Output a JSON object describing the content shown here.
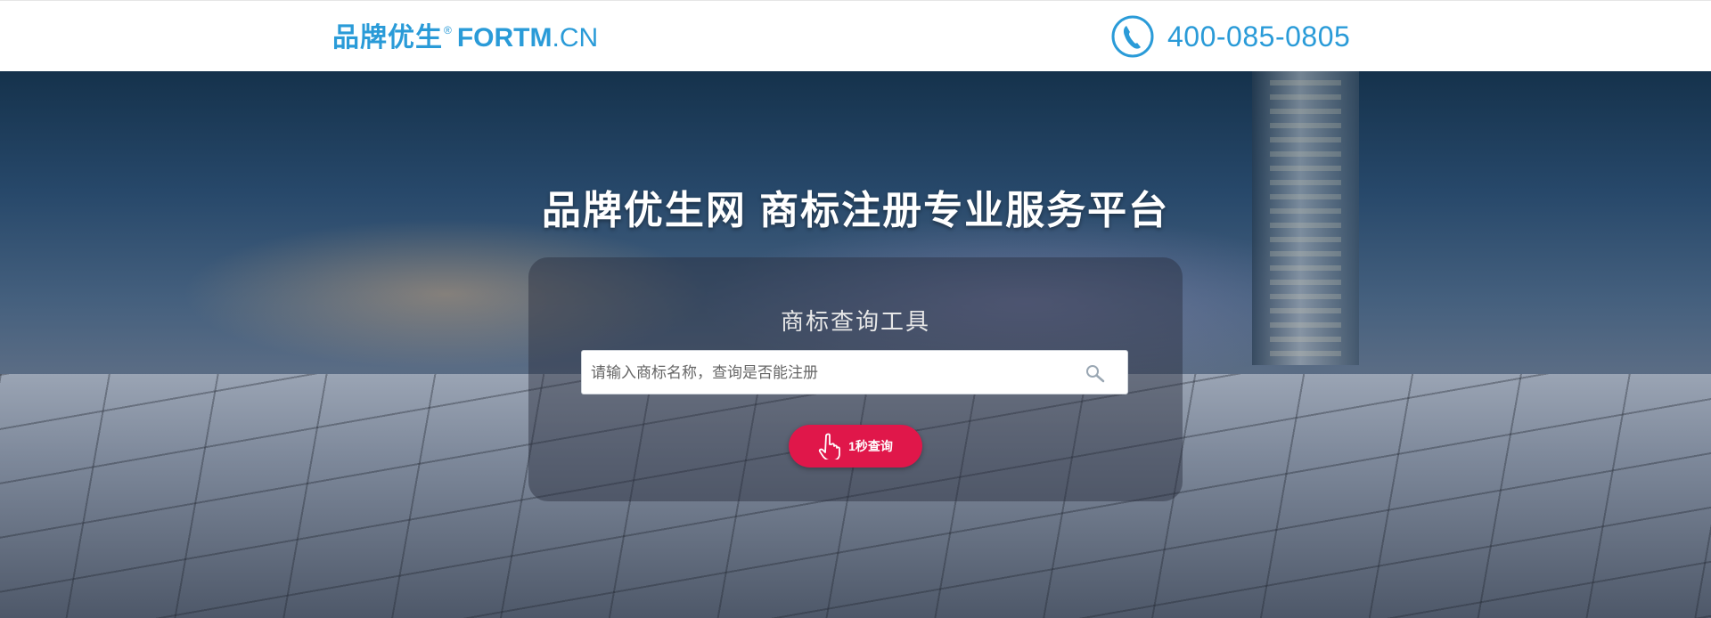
{
  "header": {
    "logo_cn": "品牌优生",
    "logo_reg": "®",
    "logo_en_bold": "FORTM",
    "logo_en_light": ".CN",
    "phone_icon": "phone-icon",
    "phone_number": "400-085-0805"
  },
  "hero": {
    "title": "品牌优生网  商标注册专业服务平台",
    "panel_title": "商标查询工具",
    "search_placeholder": "请输入商标名称，查询是否能注册",
    "search_icon": "search-icon",
    "button_icon": "hand-pointer-icon",
    "button_label": "1秒查询"
  },
  "colors": {
    "brand_blue": "#2a9bd8",
    "button_red": "#e0174a"
  }
}
